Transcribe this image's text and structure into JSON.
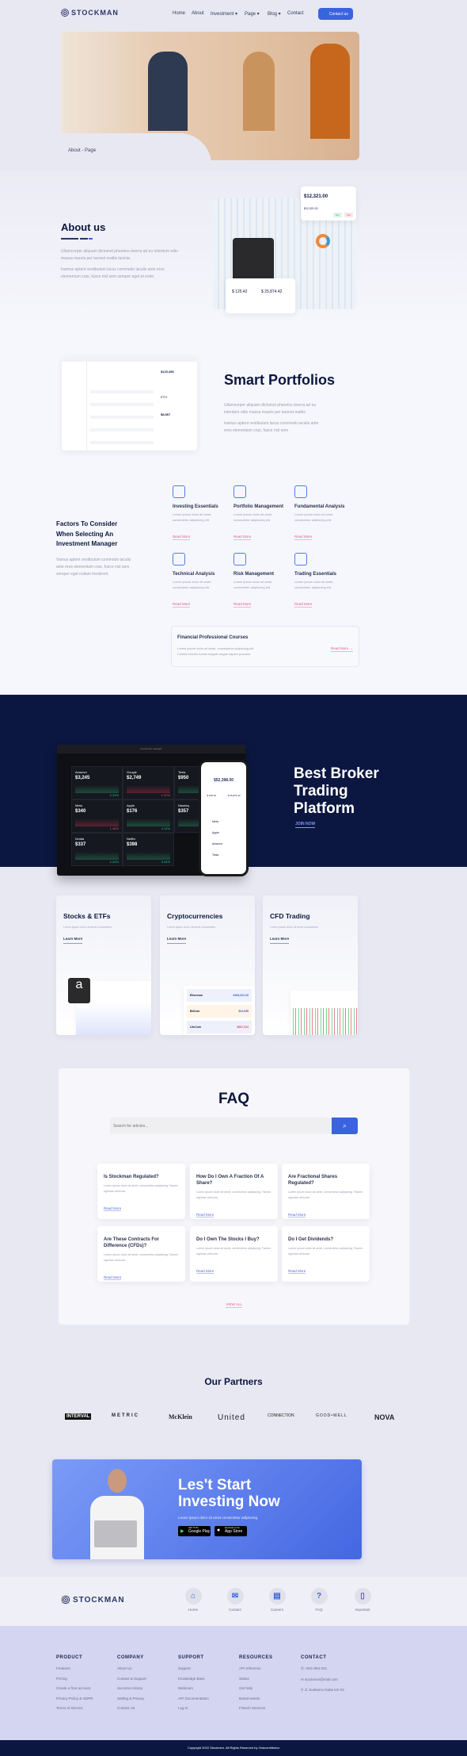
{
  "brand": "STOCKMAN",
  "nav": {
    "items": [
      "Home",
      "About",
      "Investment ▾",
      "Page ▾",
      "Blog ▾",
      "Contact"
    ],
    "contact_button": "Contact us"
  },
  "hero": {
    "breadcrumb": "About - Page"
  },
  "about": {
    "title": "About us",
    "p1": "Ullamcorper aliquam dictumst pharetra viverra ad eu interdum odio massa mauris per laoreet mattis lacinia.",
    "p2": "Ivamus aptent vestibulum lacus commodo iaculis ante eros elementum cras, fusce nisl sem semper eget et enim.",
    "card_value": "$12,321.00",
    "card_sub": "$12,321.00",
    "card_buy": "Buy",
    "card_sell": "Sell",
    "card2_a": "$ 125.42",
    "card2_b": "$ 25,874.42"
  },
  "smart": {
    "title": "Smart Portfolios",
    "p1": "Ullamcorper aliquam dictumst pharetra viverra ad eu interdum odio massa mauris per laoreet mattis",
    "p2": "ivamus aptent vestibulum lacus commodo iaculis ante eros elementum cras, fusce nisl sem",
    "mock_total": "$123,456",
    "mock_eth": "ETH",
    "mock_eth_val": "$8,567"
  },
  "factors": {
    "title": "Factors To Consider When Selecting An Investment Manager",
    "text": "Vamus aptent vestibulum commodo iaculis ante eros elementum cras, fusce nisl sem semper eget nullam hendrerit.",
    "items": [
      {
        "title": "Investing Essentials",
        "icon": "chart-growth-icon"
      },
      {
        "title": "Portfolio Management",
        "icon": "laptop-chart-icon"
      },
      {
        "title": "Fundamental Analysis",
        "icon": "head-brain-icon"
      },
      {
        "title": "Technical Analysis",
        "icon": "area-chart-icon"
      },
      {
        "title": "Risk Management",
        "icon": "dollar-target-icon"
      },
      {
        "title": "Trading Essentials",
        "icon": "bar-chart-icon"
      }
    ],
    "item_text": "Lorem ipsum dolor sit amet, consectetur adipiscing elit.",
    "read_more": "Read More",
    "course": {
      "title": "Financial Professional Courses",
      "text1": "Lorem ipsum dolor sit amet, consectetur adipiscing elit.",
      "text2": "Cubilia lobortis luctus magnis augue sapien posuere",
      "link": "Read More →"
    }
  },
  "platform": {
    "title": "Best Broker Trading Platform",
    "cta": "JOIN NOW",
    "browser_title": "Investment manager",
    "tickers": [
      {
        "name": "Amazon",
        "price": "$3,245",
        "chg": "2.31%"
      },
      {
        "name": "Google",
        "price": "$2,749",
        "chg": "1.52%"
      },
      {
        "name": "Tesla",
        "price": "$950",
        "chg": ""
      },
      {
        "name": "Meta",
        "price": "$340",
        "chg": "1.48%"
      },
      {
        "name": "Apple",
        "price": "$176",
        "chg": "0.11%"
      },
      {
        "name": "Nasdaq",
        "price": "$357",
        "chg": ""
      },
      {
        "name": "Nvidia",
        "price": "$337",
        "chg": "2.31%"
      },
      {
        "name": "Netflix",
        "price": "$398",
        "chg": "3.44%"
      }
    ],
    "phone_total": "$52,398.00",
    "phone_a": "$ 125.42",
    "phone_b": "$ 25,874.42",
    "phone_list": [
      "Meta",
      "Apple",
      "Amazon",
      "Tesla"
    ]
  },
  "products": [
    {
      "title": "Stocks & ETFs",
      "text": "Lorem ipsum dolor sit amet consectetur",
      "link": "Learn More"
    },
    {
      "title": "Cryptocurrencies",
      "text": "Lorem ipsum dolor sit amet consectetur",
      "link": "Learn More",
      "coins": [
        {
          "name": "Ethereum",
          "val": "$168,331.09"
        },
        {
          "name": "BitCoin",
          "val": "$24,098"
        },
        {
          "name": "LiteCoin",
          "val": "$667,224"
        }
      ]
    },
    {
      "title": "CFD Trading",
      "text": "Lorem ipsum dolor sit amet consectetur",
      "link": "Learn More"
    }
  ],
  "faq": {
    "title": "FAQ",
    "search_placeholder": "Search for articles...",
    "items": [
      "Is Stockman Regulated?",
      "How Do I Own A Fraction Of A Share?",
      "Are Fractional Shares Regulated?",
      "Are These Contracts For Difference (CFDs)?",
      "Do I Own The Stocks I Buy?",
      "Do I Get Dividends?"
    ],
    "item_text": "Lorem ipsum dolor sit amet, consectetur adipiscing. Fames egestas vehicula.",
    "read_more": "Read More",
    "view_all": "VIEW ALL"
  },
  "partners": {
    "title": "Our Partners",
    "logos": [
      "INTERVAL",
      "METRIC",
      "McKlein",
      "United",
      "CONNECTION",
      "GOOD•WELL",
      "NOVA"
    ]
  },
  "cta": {
    "title": "Les't Start Investing Now",
    "text": "Lorem ipsum dolor sit amet consectetur adipiscing.",
    "google": "Google Play",
    "google_small": "GET IT ON",
    "apple": "App Store",
    "apple_small": "Download on the"
  },
  "footer": {
    "quick": [
      "Home",
      "Contact",
      "Careers",
      "FAQ",
      "Important"
    ],
    "cols": [
      {
        "h": "PRODUCT",
        "links": [
          "Features",
          "Pricing",
          "Create a free account",
          "Privacy Policy & GDPR",
          "Terms of Service"
        ]
      },
      {
        "h": "COMPANY",
        "links": [
          "About Us",
          "Contact & Support",
          "Success History",
          "Setting & Privacy",
          "Contact Us"
        ]
      },
      {
        "h": "SUPPORT",
        "links": [
          "Support",
          "Knowledge Base",
          "Webinars",
          "API Documentation",
          "Log In"
        ]
      },
      {
        "h": "RESOURCES",
        "links": [
          "API reference",
          "Status",
          "Get help",
          "Brand assets",
          "Fintech Services"
        ]
      }
    ],
    "contact": {
      "h": "CONTACT",
      "phone": "+021-854-021",
      "email": "stockmen@mail.com",
      "address": "Jl. Soekarno-hatta km 03"
    },
    "copyright": "Copyright 2022 Stockmen. All Rights Reserved by Onecontributor"
  },
  "colors": {
    "primary": "#3b63e0",
    "navy": "#0b1740",
    "accent": "#e05b8b"
  }
}
